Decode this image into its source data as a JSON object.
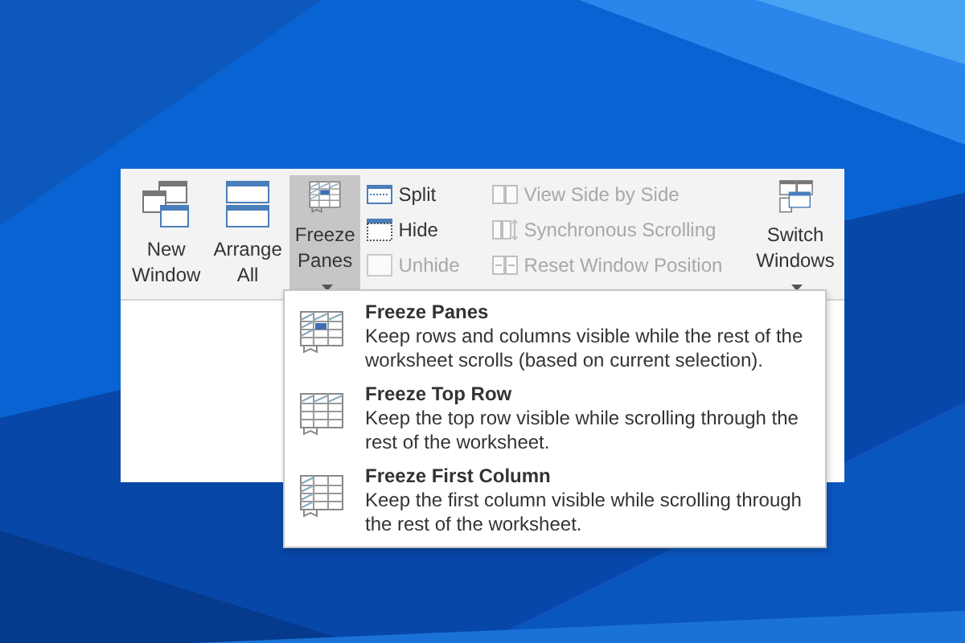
{
  "left_buttons": [
    {
      "kind": "new_window",
      "label": "New Window",
      "dropdown": false,
      "selected": false
    },
    {
      "kind": "arrange_all",
      "label": "Arrange All",
      "dropdown": false,
      "selected": false
    },
    {
      "kind": "freeze_panes",
      "label": "Freeze Panes",
      "dropdown": true,
      "selected": true
    }
  ],
  "pane_commands": [
    {
      "kind": "split",
      "label": "Split",
      "disabled": false
    },
    {
      "kind": "hide",
      "label": "Hide",
      "disabled": false
    },
    {
      "kind": "unhide",
      "label": "Unhide",
      "disabled": true
    }
  ],
  "compare_commands": [
    {
      "kind": "side_by_side",
      "label": "View Side by Side",
      "disabled": true
    },
    {
      "kind": "sync_scroll",
      "label": "Synchronous Scrolling",
      "disabled": true
    },
    {
      "kind": "reset_position",
      "label": "Reset Window Position",
      "disabled": true
    }
  ],
  "switch_button": {
    "label": "Switch Windows",
    "dropdown": true
  },
  "menu": [
    {
      "kind": "panes",
      "title": "Freeze Panes",
      "description": "Keep rows and columns visible while the rest of the worksheet scrolls (based on current selection)."
    },
    {
      "kind": "top_row",
      "title": "Freeze Top Row",
      "description": "Keep the top row visible while scrolling through the rest of the worksheet."
    },
    {
      "kind": "first_column",
      "title": "Freeze First Column",
      "description": "Keep the first column visible while scrolling through the rest of the worksheet."
    }
  ]
}
